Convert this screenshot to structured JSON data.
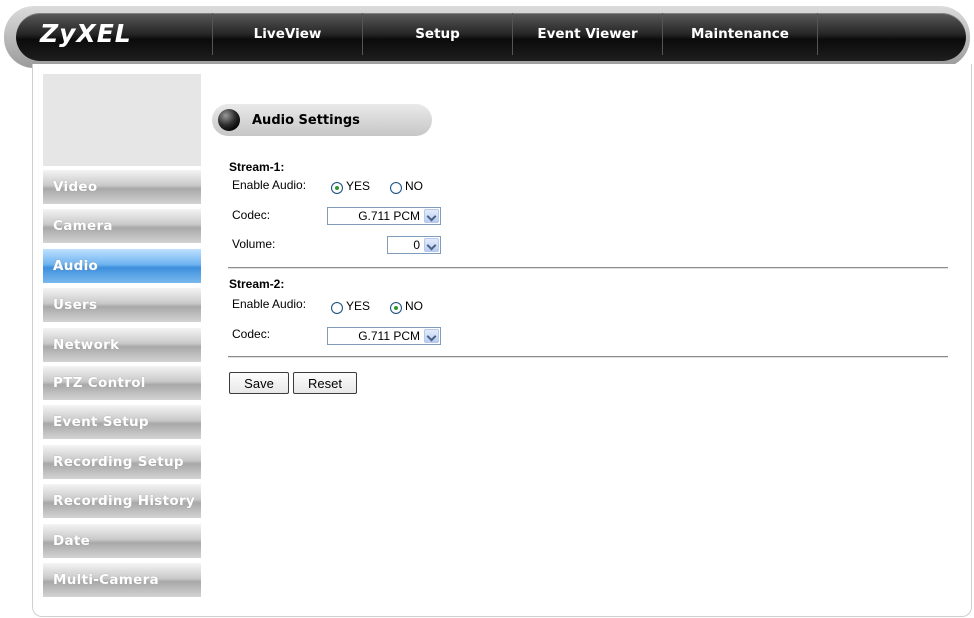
{
  "brand": {
    "logo": "ZyXEL"
  },
  "nav": {
    "tabs": [
      {
        "label": "LiveView"
      },
      {
        "label": "Setup"
      },
      {
        "label": "Event Viewer"
      },
      {
        "label": "Maintenance"
      }
    ]
  },
  "sidebar": {
    "items": [
      {
        "label": "Video"
      },
      {
        "label": "Camera"
      },
      {
        "label": "Audio",
        "active": true
      },
      {
        "label": "Users"
      },
      {
        "label": "Network"
      },
      {
        "label": "PTZ Control"
      },
      {
        "label": "Event Setup"
      },
      {
        "label": "Recording Setup"
      },
      {
        "label": "Recording History"
      },
      {
        "label": "Date"
      },
      {
        "label": "Multi-Camera"
      }
    ]
  },
  "section": {
    "title": "Audio Settings"
  },
  "stream1": {
    "heading": "Stream-1:",
    "enable_label": "Enable Audio:",
    "yes_label": "YES",
    "no_label": "NO",
    "enable_value": "YES",
    "codec_label": "Codec:",
    "codec_value": "G.711 PCM",
    "volume_label": "Volume:",
    "volume_value": "0"
  },
  "stream2": {
    "heading": "Stream-2:",
    "enable_label": "Enable Audio:",
    "yes_label": "YES",
    "no_label": "NO",
    "enable_value": "NO",
    "codec_label": "Codec:",
    "codec_value": "G.711 PCM"
  },
  "actions": {
    "save_label": "Save",
    "reset_label": "Reset"
  },
  "colors": {
    "active_tab": "#3e8fdd",
    "radio_check": "#2a9a2a"
  }
}
